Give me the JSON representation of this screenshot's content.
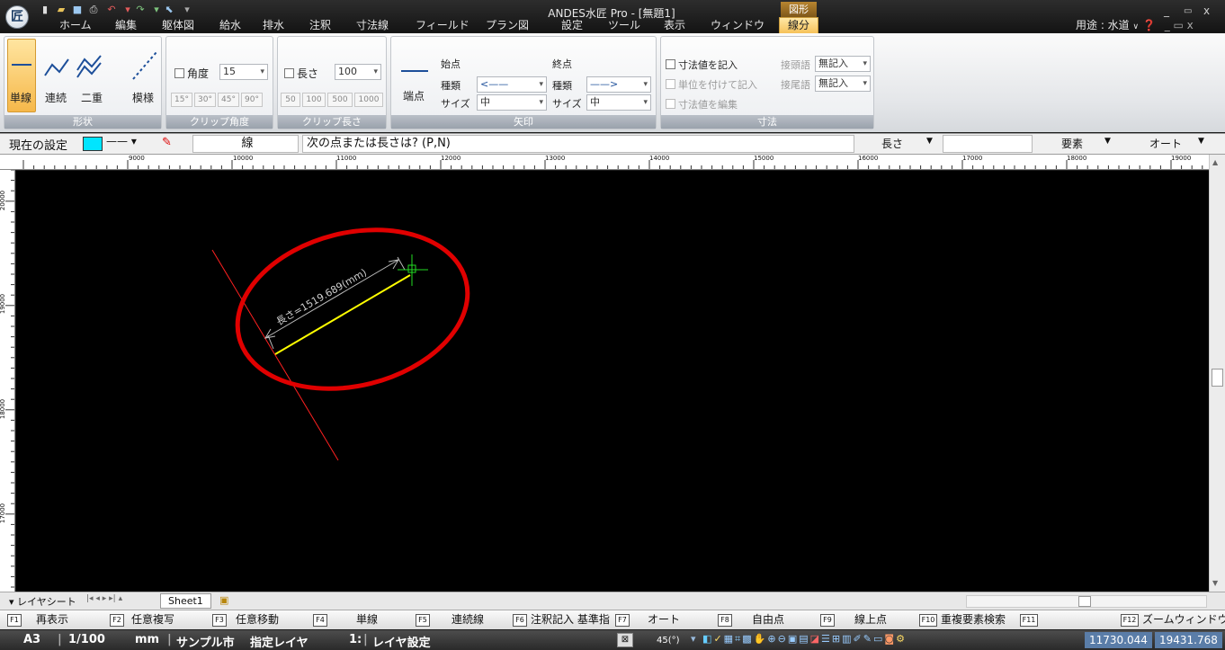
{
  "window": {
    "title": "ANDES水匠 Pro - [無題1]",
    "context_group": "図形",
    "logo_char": "匠"
  },
  "ribbon_tabs": [
    "ホーム",
    "編集",
    "躯体図",
    "給水",
    "排水",
    "注釈",
    "寸法線",
    "フィールド",
    "プラン図",
    "設定",
    "ツール",
    "表示",
    "ウィンドウ"
  ],
  "active_tab": "線分",
  "purpose": "用途 : 水道",
  "ribbon": {
    "shape": {
      "items": [
        "単線",
        "連続",
        "二重",
        "模様"
      ],
      "label": "形状"
    },
    "clip_angle": {
      "checkbox": "角度",
      "value": "15",
      "presets": [
        "15°",
        "30°",
        "45°",
        "90°"
      ],
      "label": "クリップ角度"
    },
    "clip_length": {
      "checkbox": "長さ",
      "value": "100",
      "presets": [
        "50",
        "100",
        "500",
        "1000"
      ],
      "label": "クリップ長さ"
    },
    "arrow": {
      "end_button": "端点",
      "start": "始点",
      "end": "終点",
      "kind": "種類",
      "size": "サイズ",
      "start_size": "中",
      "end_size": "中",
      "label": "矢印"
    },
    "dimension": {
      "record": "寸法値を記入",
      "with_unit": "単位を付けて記入",
      "edit": "寸法値を編集",
      "prefix_label": "接頭語",
      "prefix_value": "無記入",
      "suffix_label": "接尾語",
      "suffix_value": "無記入",
      "label": "寸法"
    }
  },
  "command_bar": {
    "current": "現在の設定",
    "line_label": "線",
    "prompt": "次の点または長さは? (P,N)",
    "length_label": "長さ",
    "element_label": "要素",
    "auto_label": "オート"
  },
  "ruler": {
    "h_labels": [
      "9000",
      "10000",
      "11000",
      "12000",
      "13000",
      "14000",
      "15000",
      "16000",
      "17000",
      "18000",
      "19000"
    ],
    "v_labels": [
      "20000",
      "19000",
      "18000",
      "17000"
    ]
  },
  "canvas": {
    "dimension_text": "長さ=1519.689(mm)"
  },
  "sheet": {
    "layer_sheet": "レイヤシート",
    "sheet_name": "Sheet1"
  },
  "function_keys": [
    {
      "key": "F1",
      "label": "再表示"
    },
    {
      "key": "F2",
      "label": "任意複写"
    },
    {
      "key": "F3",
      "label": "任意移動"
    },
    {
      "key": "F4",
      "label": "単線"
    },
    {
      "key": "F5",
      "label": "連続線"
    },
    {
      "key": "F6",
      "label": "注釈記入 基準指定"
    },
    {
      "key": "F7",
      "label": "オート"
    },
    {
      "key": "F8",
      "label": "自由点"
    },
    {
      "key": "F9",
      "label": "線上点"
    },
    {
      "key": "F10",
      "label": "重複要素検索"
    },
    {
      "key": "F11",
      "label": ""
    },
    {
      "key": "F12",
      "label": "ズームウィンドウ"
    }
  ],
  "status": {
    "paper": "A3",
    "scale": "1/100",
    "unit": "mm",
    "city": "サンプル市",
    "layer_mode": "指定レイヤ",
    "layer": "1:",
    "layer_setting": "レイヤ設定",
    "angle": "45(°)",
    "x": "11730.044",
    "y": "19431.768"
  },
  "colors": {
    "accent": "#f6c25a",
    "current_color": "#00e5ff",
    "drawn_line": "#ffff00",
    "guide_line": "#ff0000",
    "highlight_ellipse": "#e00000",
    "coord_bg": "#5a7da8"
  }
}
